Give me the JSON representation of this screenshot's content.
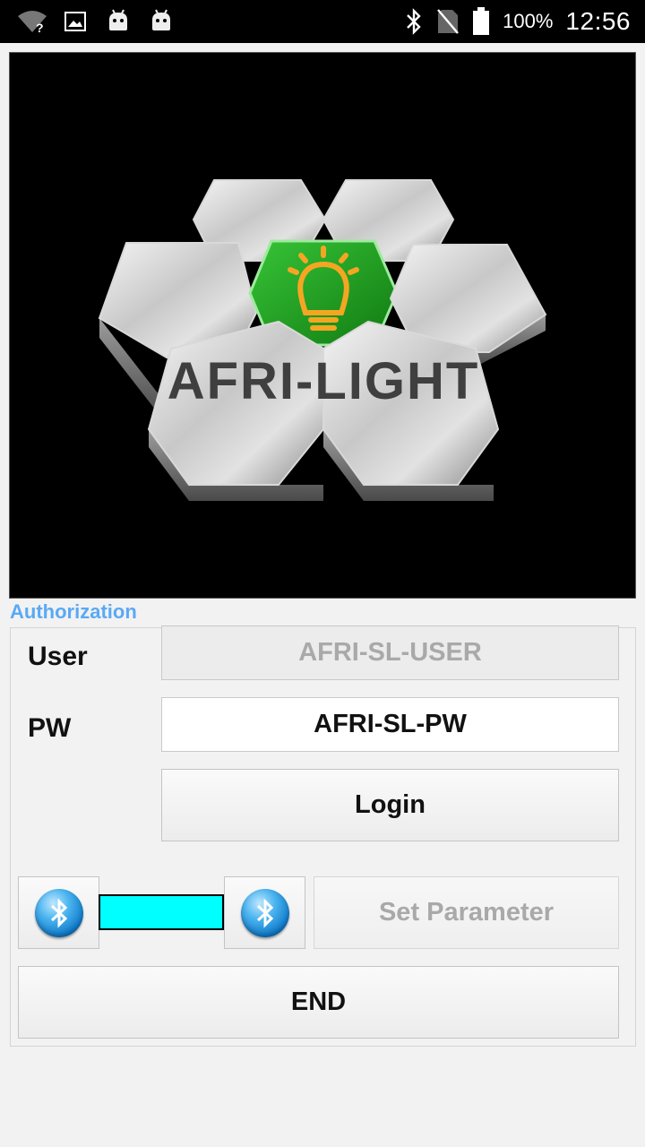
{
  "status_bar": {
    "battery_percent": "100%",
    "time": "12:56",
    "icons": [
      "wifi-unknown-icon",
      "image-icon",
      "android-icon",
      "android-icon",
      "bluetooth-icon",
      "no-sim-icon",
      "battery-icon"
    ]
  },
  "logo": {
    "brand": "AFRI-LIGHT"
  },
  "auth": {
    "section_label": "Authorization",
    "user_label": "User",
    "user_value": "AFRI-SL-USER",
    "pw_label": "PW",
    "pw_value": "AFRI-SL-PW",
    "login_label": "Login"
  },
  "controls": {
    "set_parameter_label": "Set Parameter",
    "end_label": "END",
    "indicator_color": "#00ffff"
  },
  "colors": {
    "accent": "#5aa9f5",
    "logo_green": "#1e9e1e",
    "bulb_orange": "#f4a623"
  }
}
